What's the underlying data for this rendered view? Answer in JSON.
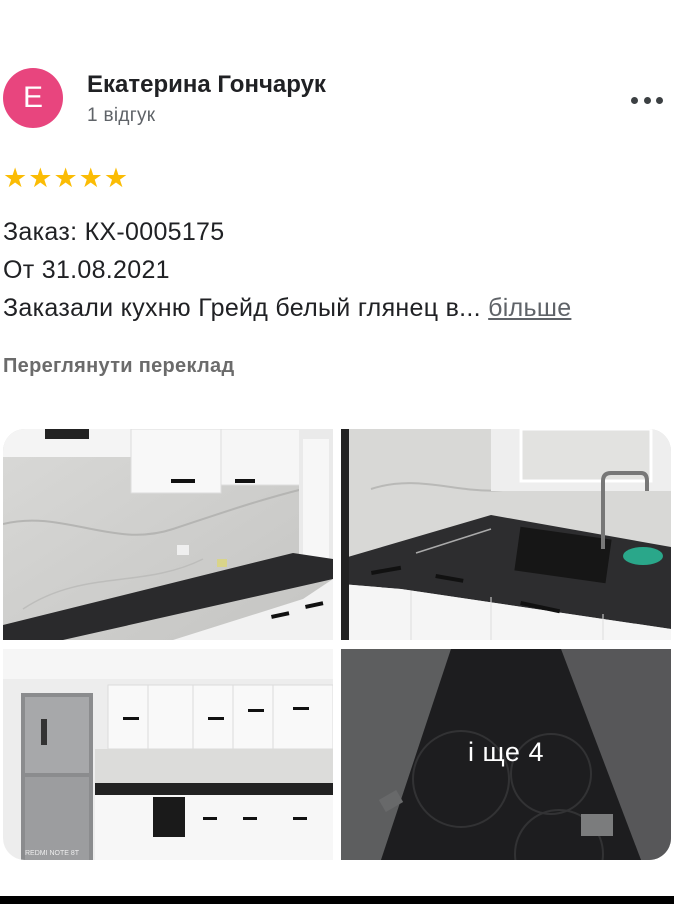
{
  "reviewer": {
    "avatar_letter": "E",
    "avatar_color": "#e8457e",
    "name": "Екатерина Гончарук",
    "review_count": "1 відгук"
  },
  "menu": {
    "icon": "more-vert-icon"
  },
  "rating": {
    "stars": 5,
    "max": 5,
    "color": "#fbbc04"
  },
  "review": {
    "line1": "Заказ: КХ-0005175",
    "line2": "От 31.08.2021",
    "line3": "Заказали кухню Грейд белый глянец в...",
    "more_label": "більше"
  },
  "translate_label": "Переглянути переклад",
  "photos": {
    "count_shown": 4,
    "more_label": "і ще 4"
  }
}
